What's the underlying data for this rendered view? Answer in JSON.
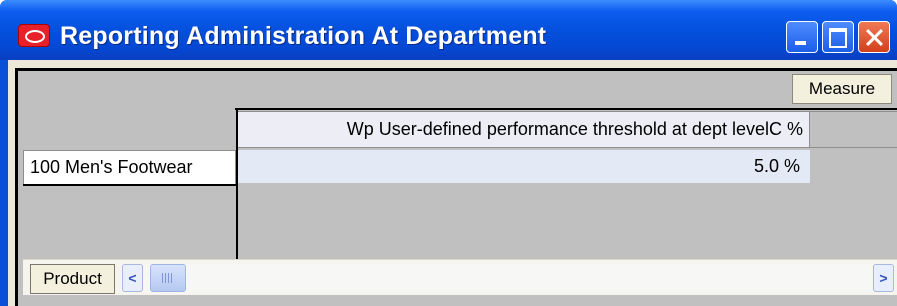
{
  "window": {
    "title": "Reporting Administration At Department",
    "controls": [
      "minimize-icon",
      "maximize-icon",
      "close-icon"
    ]
  },
  "toolbar": {
    "measure_label": "Measure",
    "product_label": "Product"
  },
  "grid": {
    "column_headers": [
      "Wp User-defined performance threshold at dept levelC %"
    ],
    "rows": [
      {
        "label": "100 Men's Footwear",
        "values": [
          "5.0 %"
        ]
      }
    ]
  },
  "scrollbar": {
    "left_arrow": "<",
    "right_arrow": ">"
  },
  "colors": {
    "titlebar": "#0450de",
    "close_button": "#d2401c",
    "grid_background": "#c0c0c0",
    "data_cell": "#e3e9f5"
  }
}
